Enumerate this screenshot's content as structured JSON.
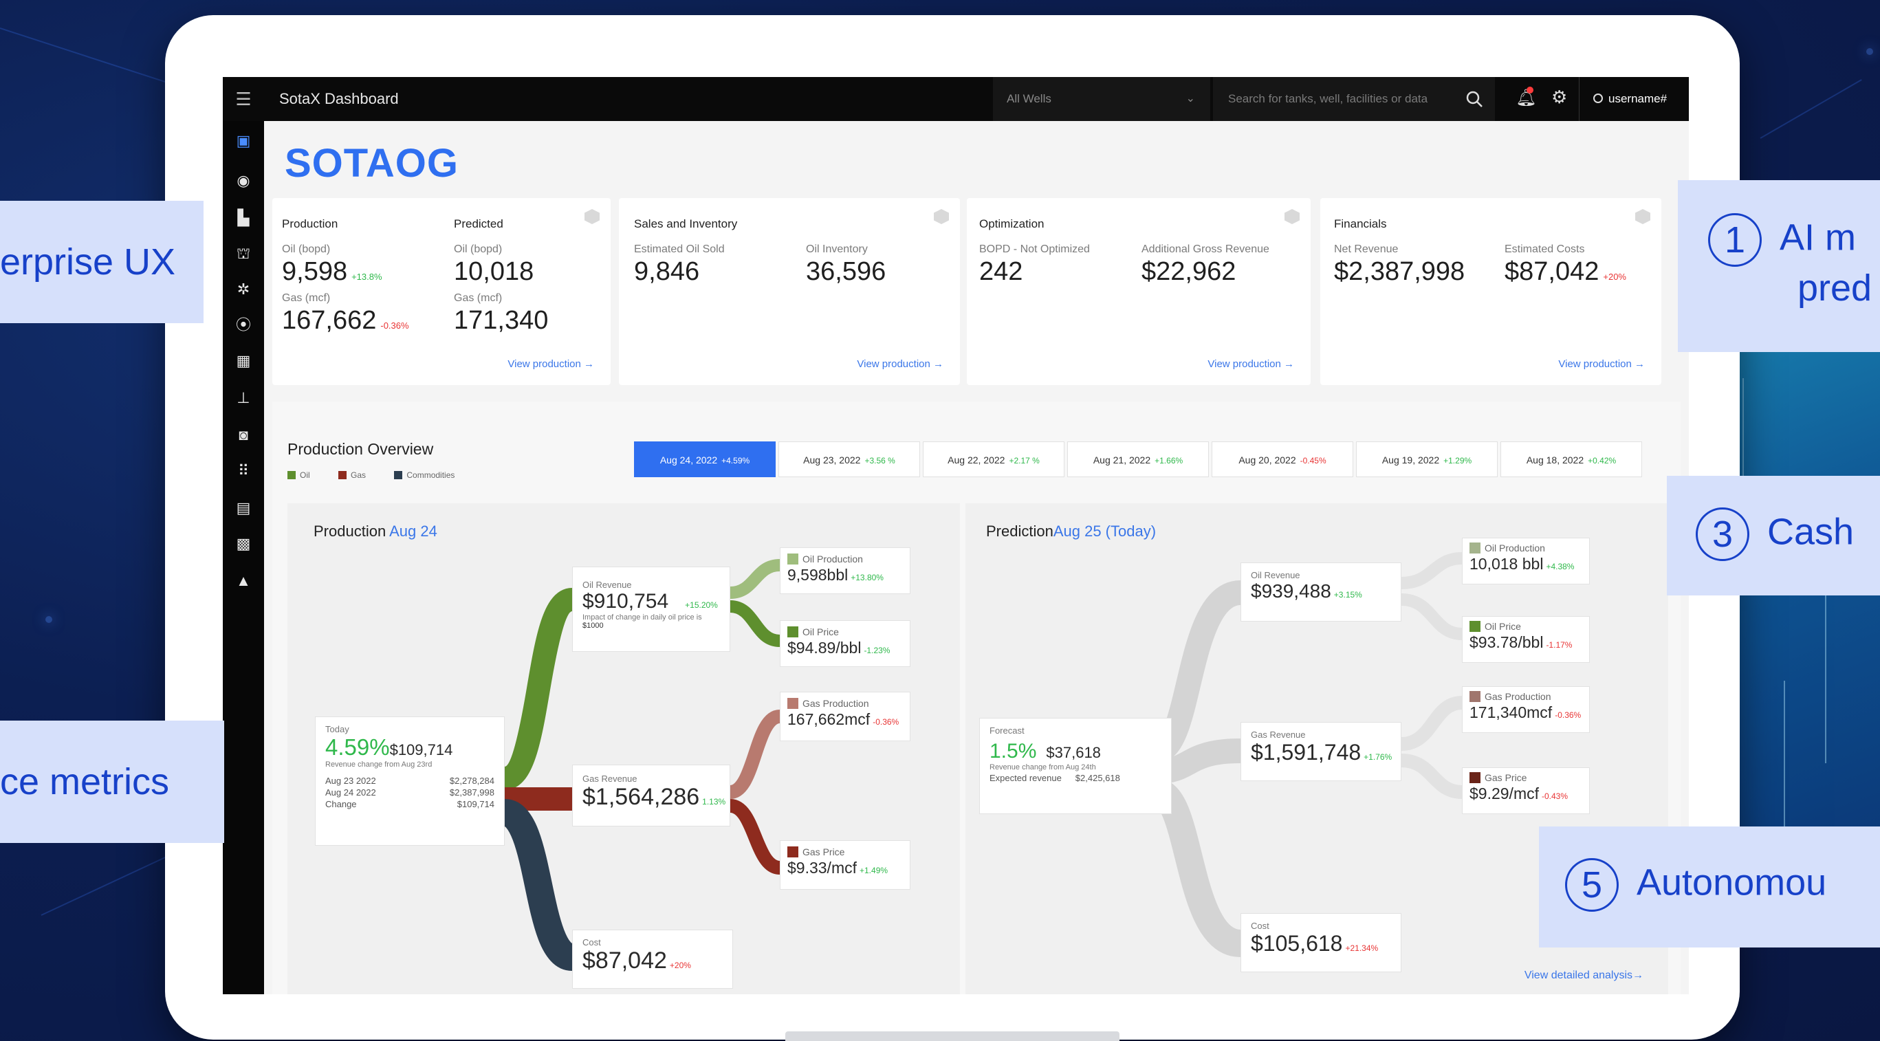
{
  "topbar": {
    "menu_icon": "hamburger-icon",
    "app_title": "SotaX Dashboard",
    "wells_select": "All Wells",
    "search_placeholder": "Search for tanks, well, facilities or data",
    "username": "username#"
  },
  "brand": "SOTAOG",
  "kpi": {
    "production": {
      "title": "Production",
      "oil_label": "Oil (bopd)",
      "oil_value": "9,598",
      "oil_change": "+13.8%",
      "gas_label": "Gas (mcf)",
      "gas_value": "167,662",
      "gas_change": "-0.36%"
    },
    "predicted": {
      "title": "Predicted",
      "oil_label": "Oil (bopd)",
      "oil_value": "10,018",
      "gas_label": "Gas (mcf)",
      "gas_value": "171,340",
      "link": "View production →"
    },
    "sales": {
      "title": "Sales and Inventory",
      "sold_label": "Estimated Oil Sold",
      "sold_value": "9,846",
      "inventory_label": "Oil Inventory",
      "inventory_value": "36,596",
      "link": "View production →"
    },
    "optimization": {
      "title": "Optimization",
      "bopd_label": "BOPD - Not Optimized",
      "bopd_value": "242",
      "revenue_label": "Additional Gross Revenue",
      "revenue_value": "$22,962",
      "link": "View production →"
    },
    "financials": {
      "title": "Financials",
      "net_label": "Net Revenue",
      "net_value": "$2,387,998",
      "costs_label": "Estimated Costs",
      "costs_value": "$87,042",
      "costs_change": "+20%",
      "link": "View production →"
    }
  },
  "overview": {
    "title": "Production Overview",
    "legend": [
      {
        "label": "Oil",
        "color": "#5e8f2e"
      },
      {
        "label": "Gas",
        "color": "#8e2b1e"
      },
      {
        "label": "Commodities",
        "color": "#2c3e50"
      }
    ],
    "dates": [
      {
        "date": "Aug 24, 2022",
        "change": "+4.59%",
        "active": true
      },
      {
        "date": "Aug 23, 2022",
        "change": "+3.56 %"
      },
      {
        "date": "Aug 22, 2022",
        "change": "+2.17 %"
      },
      {
        "date": "Aug 21, 2022",
        "change": "+1.66%"
      },
      {
        "date": "Aug 20, 2022",
        "change": "-0.45%"
      },
      {
        "date": "Aug 19, 2022",
        "change": "+1.29%"
      },
      {
        "date": "Aug 18, 2022",
        "change": "+0.42%"
      }
    ]
  },
  "production_flow": {
    "title": "Production ",
    "title_date": "Aug 24",
    "today": {
      "label": "Today",
      "pct": "4.59%",
      "amount": "$109,714",
      "note": "Revenue change from Aug 23rd",
      "rows": [
        {
          "k": "Aug 23 2022",
          "v": "$2,278,284"
        },
        {
          "k": "Aug 24 2022",
          "v": "$2,387,998"
        },
        {
          "k": "Change",
          "v": "$109,714"
        }
      ]
    },
    "oil_revenue": {
      "label": "Oil Revenue",
      "value": "$910,754",
      "change": "+15.20%",
      "note": "Impact of change in daily oil price is",
      "note2": "$1000"
    },
    "gas_revenue": {
      "label": "Gas Revenue",
      "value": "$1,564,286",
      "change": "1.13%"
    },
    "cost": {
      "label": "Cost",
      "value": "$87,042",
      "change": "+20%"
    },
    "oil_production": {
      "label": "Oil Production",
      "value": "9,598bbl",
      "change": "+13.80%"
    },
    "oil_price": {
      "label": "Oil Price",
      "value": "$94.89/bbl",
      "change": "-1.23%"
    },
    "gas_production": {
      "label": "Gas Production",
      "value": "167,662mcf",
      "change": "-0.36%"
    },
    "gas_price": {
      "label": "Gas Price",
      "value": "$9.33/mcf",
      "change": "+1.49%"
    }
  },
  "prediction_flow": {
    "title": "Prediction",
    "title_date": "Aug 25 (Today)",
    "forecast": {
      "label": "Forecast",
      "pct": "1.5%",
      "amount": "$37,618",
      "note": "Revenue change from Aug 24th",
      "row_k": "Expected revenue",
      "row_v": "$2,425,618"
    },
    "oil_revenue": {
      "label": "Oil Revenue",
      "value": "$939,488",
      "change": "+3.15%"
    },
    "gas_revenue": {
      "label": "Gas Revenue",
      "value": "$1,591,748",
      "change": "+1.76%"
    },
    "cost": {
      "label": "Cost",
      "value": "$105,618",
      "change": "+21.34%"
    },
    "oil_production": {
      "label": "Oil Production",
      "value": "10,018 bbl",
      "change": "+4.38%"
    },
    "oil_price": {
      "label": "Oil Price",
      "value": "$93.78/bbl",
      "change": "-1.17%"
    },
    "gas_production": {
      "label": "Gas Production",
      "value": "171,340mcf",
      "change": "-0.36%"
    },
    "gas_price": {
      "label": "Gas Price",
      "value": "$9.29/mcf",
      "change": "-0.43%"
    },
    "link": "View detailed analysis→"
  },
  "callouts": {
    "enterprise": "erprise UX",
    "metrics": "ce metrics",
    "c1_num": "1",
    "c1_line1": "AI m",
    "c1_line2": "pred",
    "c3_num": "3",
    "c3_text": "Cash",
    "c5_num": "5",
    "c5_text": "Autonomou"
  },
  "colors": {
    "accent": "#2f6ff0",
    "oil": "#5e8f2e",
    "gas": "#8e2b1e",
    "cost": "#2c3e50",
    "callout_bg": "#d6e0fb",
    "callout_text": "#1741c9"
  }
}
